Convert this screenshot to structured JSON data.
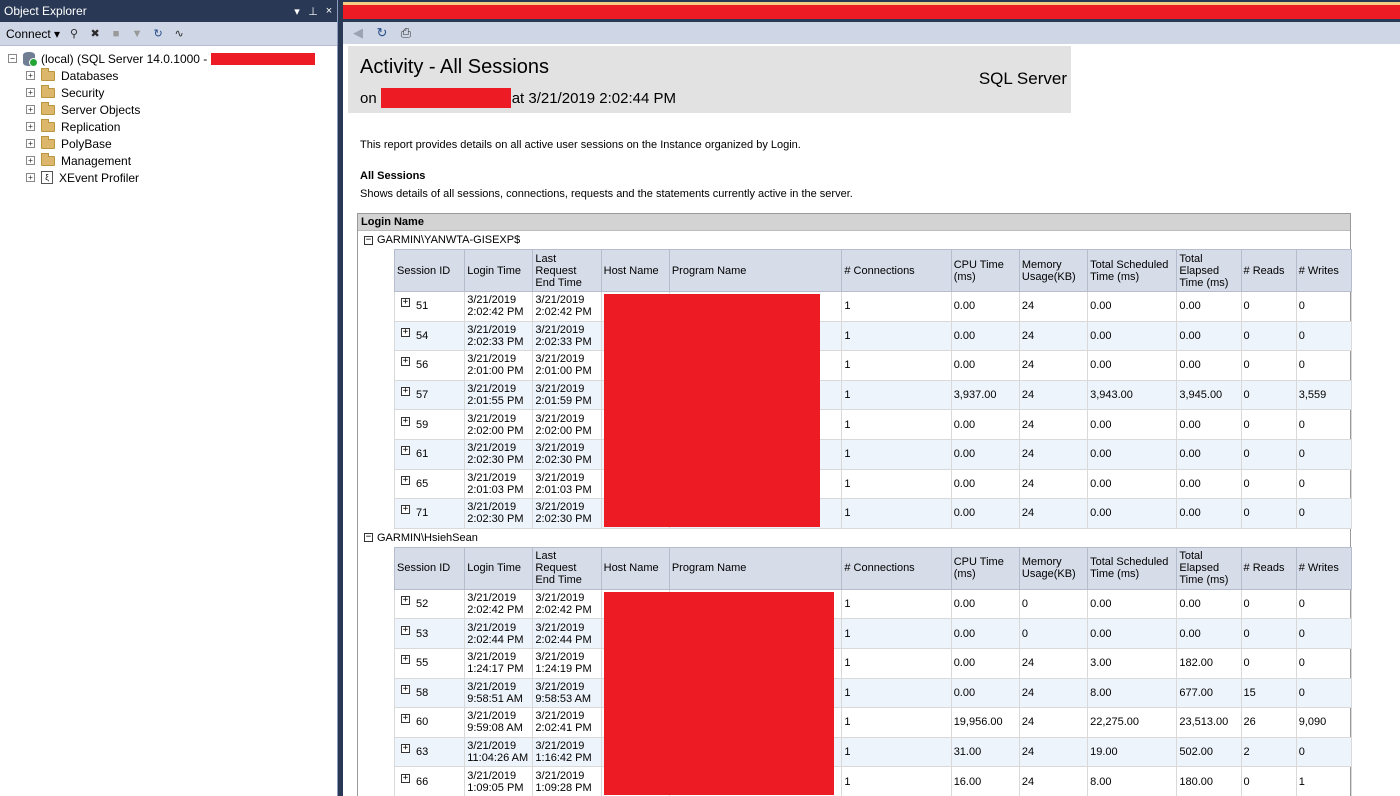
{
  "object_explorer": {
    "title": "Object Explorer",
    "title_buttons": [
      "▾",
      "ᵖ",
      "×"
    ],
    "toolbar": {
      "connect_label": "Connect ▾"
    },
    "server_label": "(local) (SQL Server 14.0.1000 -",
    "nodes": [
      {
        "label": "Databases",
        "icon": "folder-icon"
      },
      {
        "label": "Security",
        "icon": "folder-icon"
      },
      {
        "label": "Server Objects",
        "icon": "folder-icon"
      },
      {
        "label": "Replication",
        "icon": "folder-icon"
      },
      {
        "label": "PolyBase",
        "icon": "folder-icon"
      },
      {
        "label": "Management",
        "icon": "folder-icon"
      },
      {
        "label": "XEvent Profiler",
        "icon": "xevent-icon"
      }
    ]
  },
  "report": {
    "title": "Activity - All Sessions",
    "subtitle_on": "on",
    "subtitle_at": "at 3/21/2019 2:02:44 PM",
    "product": "SQL Server",
    "description": "This report provides details on all active user sessions on the Instance organized by Login.",
    "section_title": "All Sessions",
    "section_description": "Shows details of all sessions, connections, requests and the statements currently active in the server.",
    "login_header": "Login Name",
    "columns": [
      "Session ID",
      "Login Time",
      "Last Request End Time",
      "Host Name",
      "Program Name",
      "# Connections",
      "CPU Time (ms)",
      "Memory Usage(KB)",
      "Total Scheduled Time (ms)",
      "Total Elapsed Time (ms)",
      "# Reads",
      "# Writes"
    ],
    "groups": [
      {
        "login": "GARMIN\\YANWTA-GISEXP$",
        "rows": [
          [
            "51",
            "3/21/2019 2:02:42 PM",
            "3/21/2019 2:02:42 PM",
            "",
            "",
            "1",
            "0.00",
            "24",
            "0.00",
            "0.00",
            "0",
            "0"
          ],
          [
            "54",
            "3/21/2019 2:02:33 PM",
            "3/21/2019 2:02:33 PM",
            "",
            "",
            "1",
            "0.00",
            "24",
            "0.00",
            "0.00",
            "0",
            "0"
          ],
          [
            "56",
            "3/21/2019 2:01:00 PM",
            "3/21/2019 2:01:00 PM",
            "",
            "",
            "1",
            "0.00",
            "24",
            "0.00",
            "0.00",
            "0",
            "0"
          ],
          [
            "57",
            "3/21/2019 2:01:55 PM",
            "3/21/2019 2:01:59 PM",
            "",
            "",
            "1",
            "3,937.00",
            "24",
            "3,943.00",
            "3,945.00",
            "0",
            "3,559"
          ],
          [
            "59",
            "3/21/2019 2:02:00 PM",
            "3/21/2019 2:02:00 PM",
            "",
            "",
            "1",
            "0.00",
            "24",
            "0.00",
            "0.00",
            "0",
            "0"
          ],
          [
            "61",
            "3/21/2019 2:02:30 PM",
            "3/21/2019 2:02:30 PM",
            "",
            "",
            "1",
            "0.00",
            "24",
            "0.00",
            "0.00",
            "0",
            "0"
          ],
          [
            "65",
            "3/21/2019 2:01:03 PM",
            "3/21/2019 2:01:03 PM",
            "",
            "",
            "1",
            "0.00",
            "24",
            "0.00",
            "0.00",
            "0",
            "0"
          ],
          [
            "71",
            "3/21/2019 2:02:30 PM",
            "3/21/2019 2:02:30 PM",
            "",
            "",
            "1",
            "0.00",
            "24",
            "0.00",
            "0.00",
            "0",
            "0"
          ]
        ]
      },
      {
        "login": "GARMIN\\HsiehSean",
        "rows": [
          [
            "52",
            "3/21/2019 2:02:42 PM",
            "3/21/2019 2:02:42 PM",
            "",
            "",
            "1",
            "0.00",
            "0",
            "0.00",
            "0.00",
            "0",
            "0"
          ],
          [
            "53",
            "3/21/2019 2:02:44 PM",
            "3/21/2019 2:02:44 PM",
            "",
            "",
            "1",
            "0.00",
            "0",
            "0.00",
            "0.00",
            "0",
            "0"
          ],
          [
            "55",
            "3/21/2019 1:24:17 PM",
            "3/21/2019 1:24:19 PM",
            "",
            "",
            "1",
            "0.00",
            "24",
            "3.00",
            "182.00",
            "0",
            "0"
          ],
          [
            "58",
            "3/21/2019 9:58:51 AM",
            "3/21/2019 9:58:53 AM",
            "",
            "",
            "1",
            "0.00",
            "24",
            "8.00",
            "677.00",
            "15",
            "0"
          ],
          [
            "60",
            "3/21/2019 9:59:08 AM",
            "3/21/2019 2:02:41 PM",
            "",
            "",
            "1",
            "19,956.00",
            "24",
            "22,275.00",
            "23,513.00",
            "26",
            "9,090"
          ],
          [
            "63",
            "3/21/2019 11:04:26 AM",
            "3/21/2019 1:16:42 PM",
            "",
            "",
            "1",
            "31.00",
            "24",
            "19.00",
            "502.00",
            "2",
            "0"
          ],
          [
            "66",
            "3/21/2019 1:09:05 PM",
            "3/21/2019 1:09:28 PM",
            "",
            "",
            "1",
            "16.00",
            "24",
            "8.00",
            "180.00",
            "0",
            "1"
          ]
        ]
      }
    ]
  },
  "colors": {
    "redaction": "#ed1c24",
    "chrome": "#293955",
    "toolbar": "#cfd6e5"
  }
}
